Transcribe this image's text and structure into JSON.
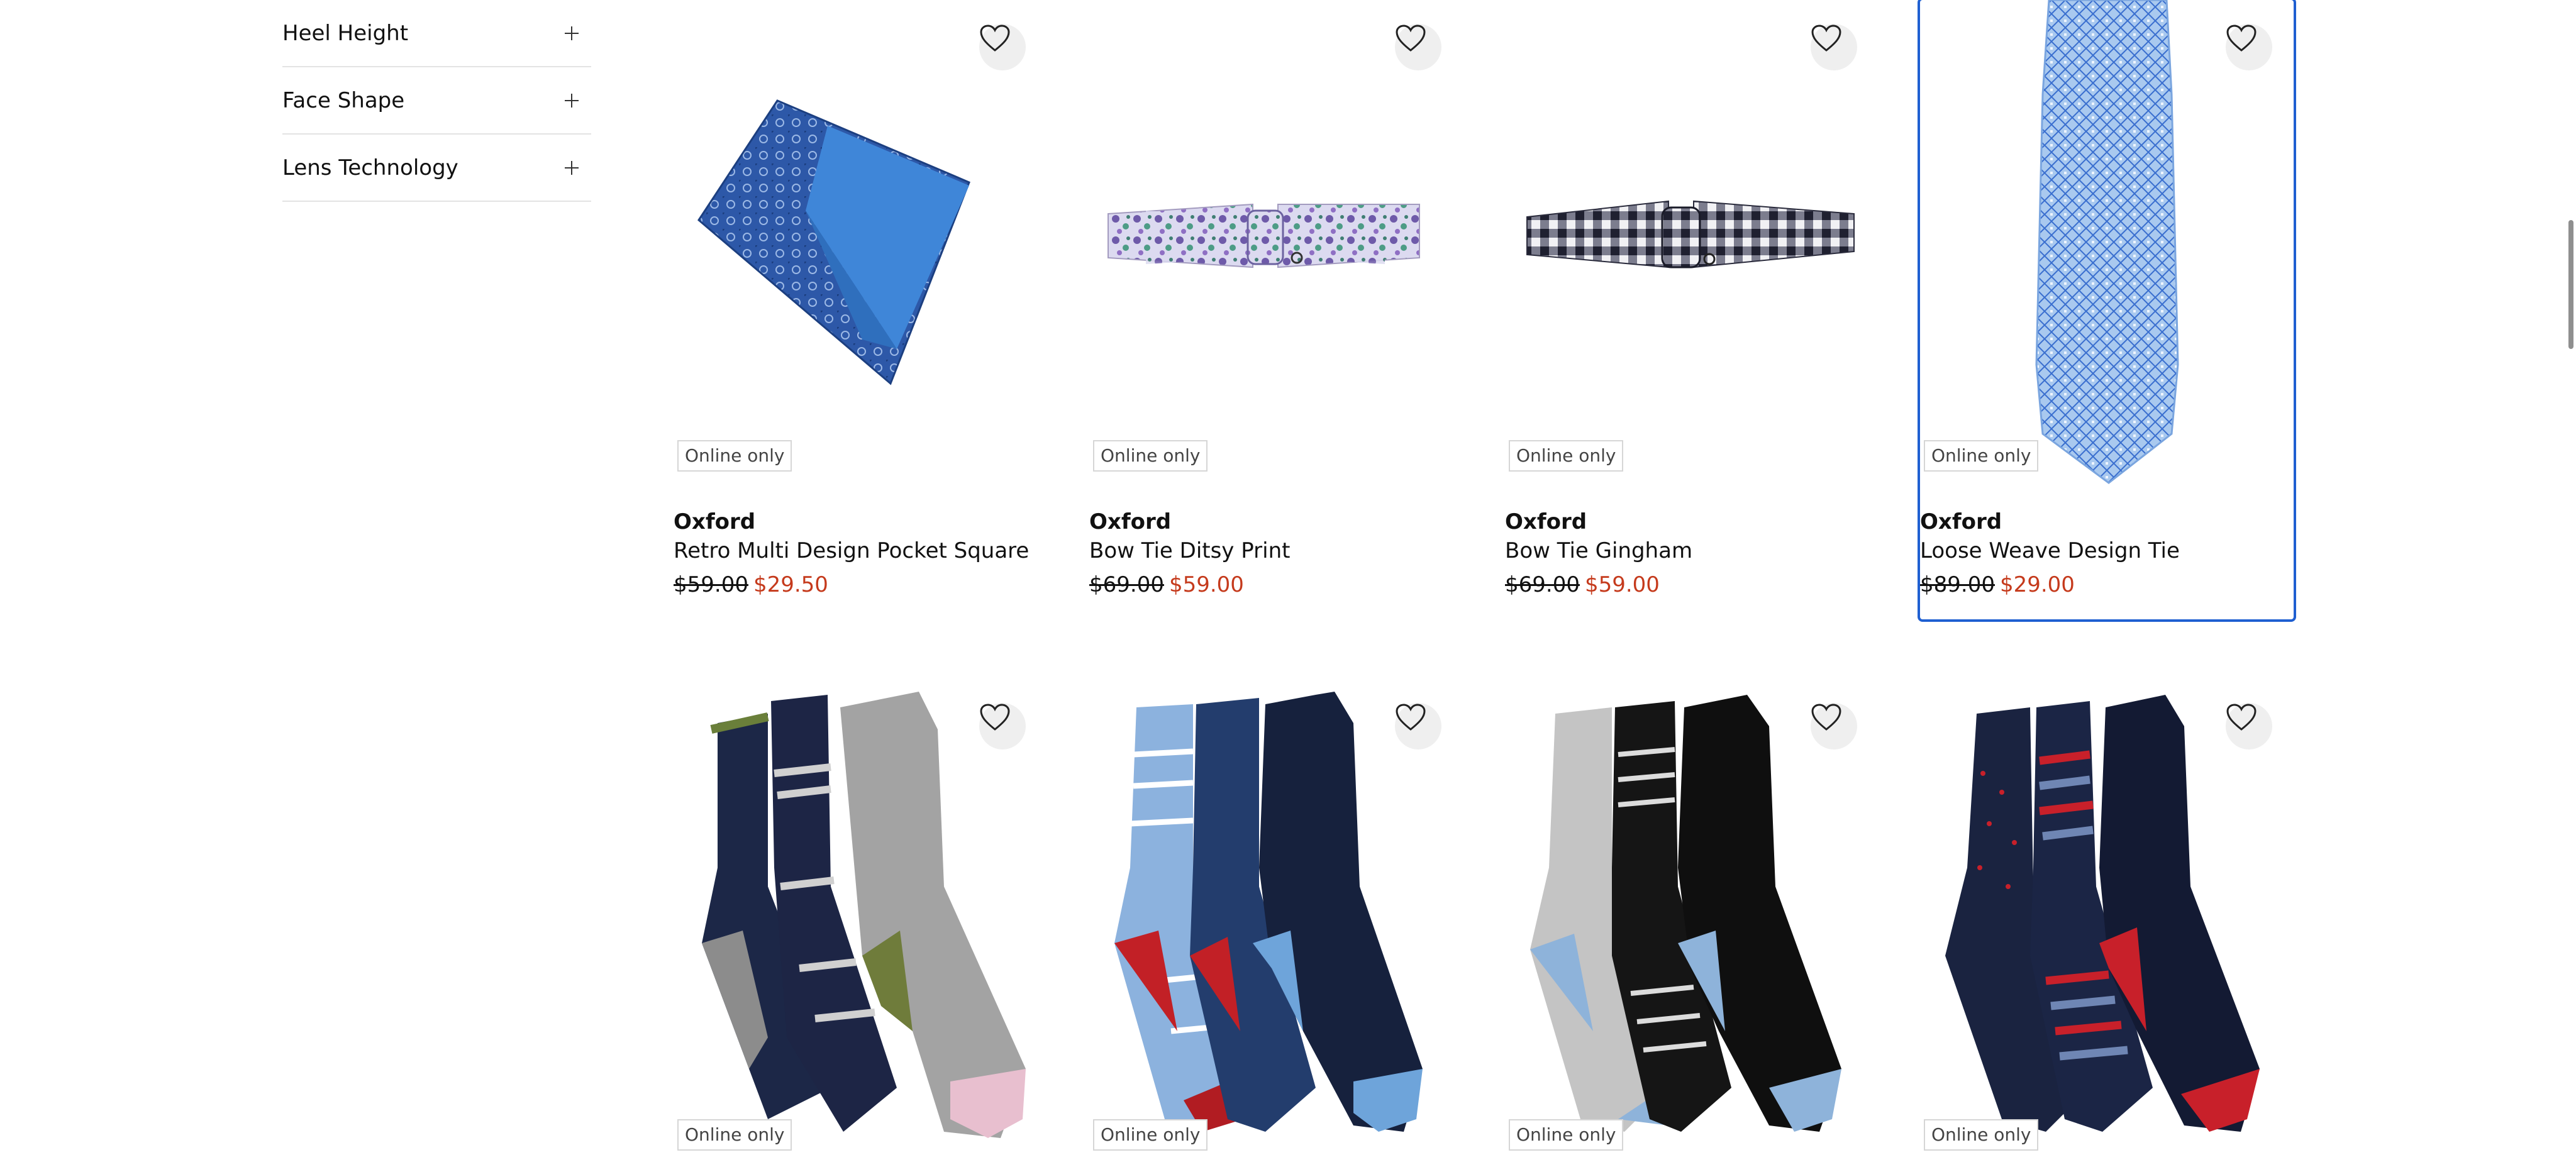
{
  "filters": [
    {
      "label": "Heel Height"
    },
    {
      "label": "Face Shape"
    },
    {
      "label": "Lens Technology"
    }
  ],
  "badge_text": "Online only",
  "colors": {
    "sale": "#c53a1c",
    "highlight": "#1f5fd1"
  },
  "products": [
    {
      "brand": "Oxford",
      "name": "Retro Multi Design Pocket Square",
      "old_price": "$59.00",
      "sale_price": "$29.50",
      "image": "pocket-square"
    },
    {
      "brand": "Oxford",
      "name": "Bow Tie Ditsy Print",
      "old_price": "$69.00",
      "sale_price": "$59.00",
      "image": "floral-bow-tie"
    },
    {
      "brand": "Oxford",
      "name": "Bow Tie Gingham",
      "old_price": "$69.00",
      "sale_price": "$59.00",
      "image": "gingham-bow-tie"
    },
    {
      "brand": "Oxford",
      "name": "Loose Weave Design Tie",
      "old_price": "$89.00",
      "sale_price": "$29.00",
      "image": "blue-tie"
    },
    {
      "image": "socks-palm-stripe-grey"
    },
    {
      "image": "socks-blue-stripe-floral-navy"
    },
    {
      "image": "socks-grey-stripe-black"
    },
    {
      "image": "socks-navy-dot-stripe"
    }
  ]
}
